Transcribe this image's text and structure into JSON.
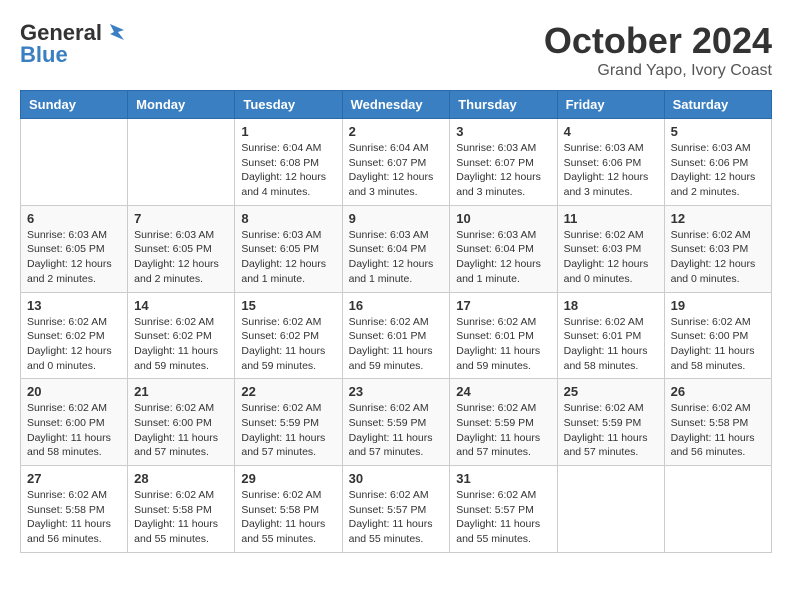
{
  "logo": {
    "general": "General",
    "blue": "Blue"
  },
  "title": {
    "month": "October 2024",
    "location": "Grand Yapo, Ivory Coast"
  },
  "weekdays": [
    "Sunday",
    "Monday",
    "Tuesday",
    "Wednesday",
    "Thursday",
    "Friday",
    "Saturday"
  ],
  "weeks": [
    [
      {
        "day": "",
        "info": ""
      },
      {
        "day": "",
        "info": ""
      },
      {
        "day": "1",
        "info": "Sunrise: 6:04 AM\nSunset: 6:08 PM\nDaylight: 12 hours and 4 minutes."
      },
      {
        "day": "2",
        "info": "Sunrise: 6:04 AM\nSunset: 6:07 PM\nDaylight: 12 hours and 3 minutes."
      },
      {
        "day": "3",
        "info": "Sunrise: 6:03 AM\nSunset: 6:07 PM\nDaylight: 12 hours and 3 minutes."
      },
      {
        "day": "4",
        "info": "Sunrise: 6:03 AM\nSunset: 6:06 PM\nDaylight: 12 hours and 3 minutes."
      },
      {
        "day": "5",
        "info": "Sunrise: 6:03 AM\nSunset: 6:06 PM\nDaylight: 12 hours and 2 minutes."
      }
    ],
    [
      {
        "day": "6",
        "info": "Sunrise: 6:03 AM\nSunset: 6:05 PM\nDaylight: 12 hours and 2 minutes."
      },
      {
        "day": "7",
        "info": "Sunrise: 6:03 AM\nSunset: 6:05 PM\nDaylight: 12 hours and 2 minutes."
      },
      {
        "day": "8",
        "info": "Sunrise: 6:03 AM\nSunset: 6:05 PM\nDaylight: 12 hours and 1 minute."
      },
      {
        "day": "9",
        "info": "Sunrise: 6:03 AM\nSunset: 6:04 PM\nDaylight: 12 hours and 1 minute."
      },
      {
        "day": "10",
        "info": "Sunrise: 6:03 AM\nSunset: 6:04 PM\nDaylight: 12 hours and 1 minute."
      },
      {
        "day": "11",
        "info": "Sunrise: 6:02 AM\nSunset: 6:03 PM\nDaylight: 12 hours and 0 minutes."
      },
      {
        "day": "12",
        "info": "Sunrise: 6:02 AM\nSunset: 6:03 PM\nDaylight: 12 hours and 0 minutes."
      }
    ],
    [
      {
        "day": "13",
        "info": "Sunrise: 6:02 AM\nSunset: 6:02 PM\nDaylight: 12 hours and 0 minutes."
      },
      {
        "day": "14",
        "info": "Sunrise: 6:02 AM\nSunset: 6:02 PM\nDaylight: 11 hours and 59 minutes."
      },
      {
        "day": "15",
        "info": "Sunrise: 6:02 AM\nSunset: 6:02 PM\nDaylight: 11 hours and 59 minutes."
      },
      {
        "day": "16",
        "info": "Sunrise: 6:02 AM\nSunset: 6:01 PM\nDaylight: 11 hours and 59 minutes."
      },
      {
        "day": "17",
        "info": "Sunrise: 6:02 AM\nSunset: 6:01 PM\nDaylight: 11 hours and 59 minutes."
      },
      {
        "day": "18",
        "info": "Sunrise: 6:02 AM\nSunset: 6:01 PM\nDaylight: 11 hours and 58 minutes."
      },
      {
        "day": "19",
        "info": "Sunrise: 6:02 AM\nSunset: 6:00 PM\nDaylight: 11 hours and 58 minutes."
      }
    ],
    [
      {
        "day": "20",
        "info": "Sunrise: 6:02 AM\nSunset: 6:00 PM\nDaylight: 11 hours and 58 minutes."
      },
      {
        "day": "21",
        "info": "Sunrise: 6:02 AM\nSunset: 6:00 PM\nDaylight: 11 hours and 57 minutes."
      },
      {
        "day": "22",
        "info": "Sunrise: 6:02 AM\nSunset: 5:59 PM\nDaylight: 11 hours and 57 minutes."
      },
      {
        "day": "23",
        "info": "Sunrise: 6:02 AM\nSunset: 5:59 PM\nDaylight: 11 hours and 57 minutes."
      },
      {
        "day": "24",
        "info": "Sunrise: 6:02 AM\nSunset: 5:59 PM\nDaylight: 11 hours and 57 minutes."
      },
      {
        "day": "25",
        "info": "Sunrise: 6:02 AM\nSunset: 5:59 PM\nDaylight: 11 hours and 57 minutes."
      },
      {
        "day": "26",
        "info": "Sunrise: 6:02 AM\nSunset: 5:58 PM\nDaylight: 11 hours and 56 minutes."
      }
    ],
    [
      {
        "day": "27",
        "info": "Sunrise: 6:02 AM\nSunset: 5:58 PM\nDaylight: 11 hours and 56 minutes."
      },
      {
        "day": "28",
        "info": "Sunrise: 6:02 AM\nSunset: 5:58 PM\nDaylight: 11 hours and 55 minutes."
      },
      {
        "day": "29",
        "info": "Sunrise: 6:02 AM\nSunset: 5:58 PM\nDaylight: 11 hours and 55 minutes."
      },
      {
        "day": "30",
        "info": "Sunrise: 6:02 AM\nSunset: 5:57 PM\nDaylight: 11 hours and 55 minutes."
      },
      {
        "day": "31",
        "info": "Sunrise: 6:02 AM\nSunset: 5:57 PM\nDaylight: 11 hours and 55 minutes."
      },
      {
        "day": "",
        "info": ""
      },
      {
        "day": "",
        "info": ""
      }
    ]
  ]
}
